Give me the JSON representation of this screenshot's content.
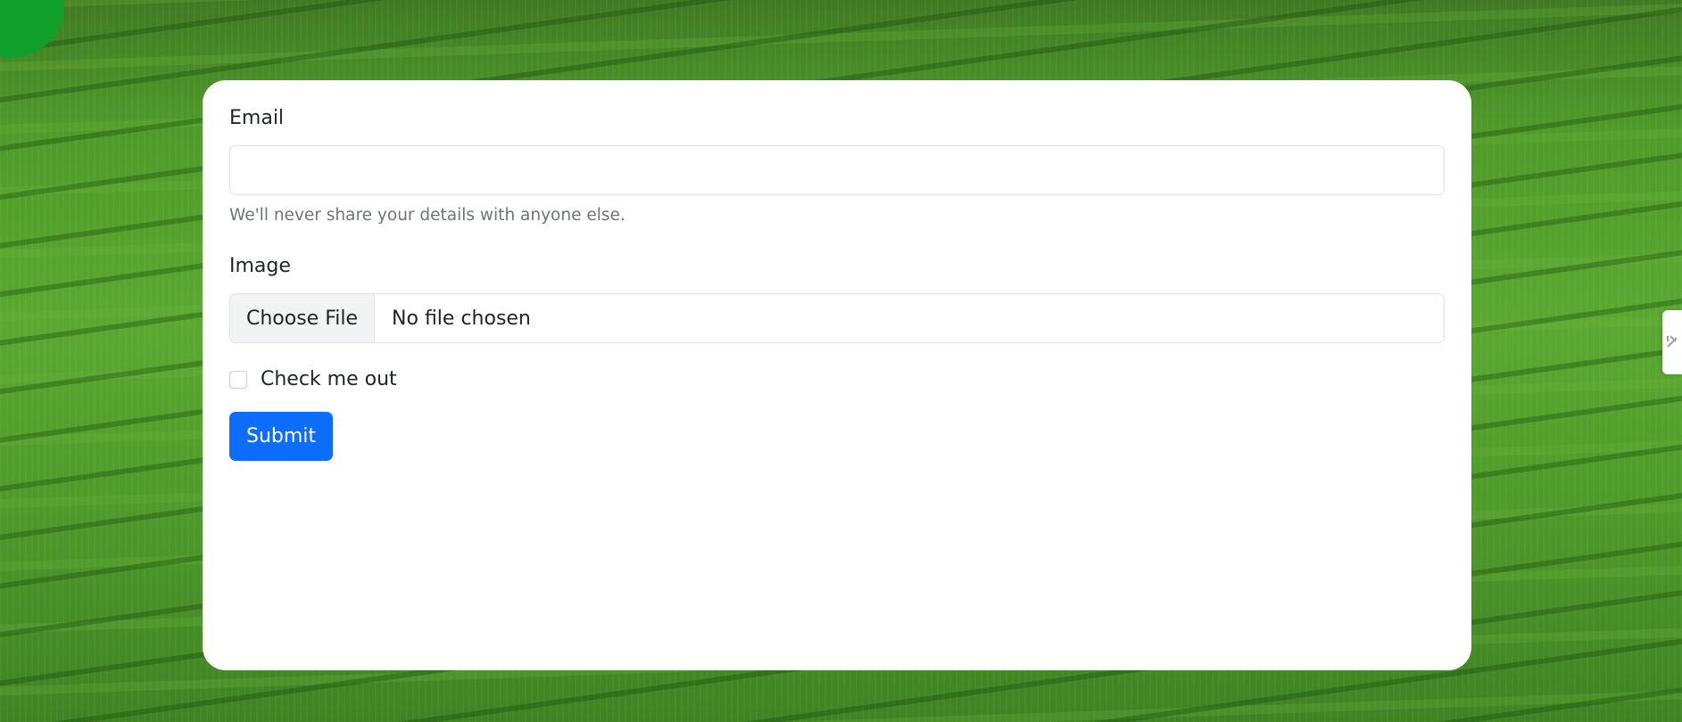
{
  "form": {
    "email_label": "Email",
    "email_value": "",
    "email_help": "We'll never share your details with anyone else.",
    "image_label": "Image",
    "file_button_label": "Choose File",
    "file_status": "No file chosen",
    "checkbox_label": "Check me out",
    "checkbox_checked": false,
    "submit_label": "Submit"
  },
  "colors": {
    "accent": "#0d6efd",
    "corner_circle": "#0f9f2a",
    "card_background": "#ffffff"
  },
  "icons": {
    "side_tab": "tool-icon"
  }
}
